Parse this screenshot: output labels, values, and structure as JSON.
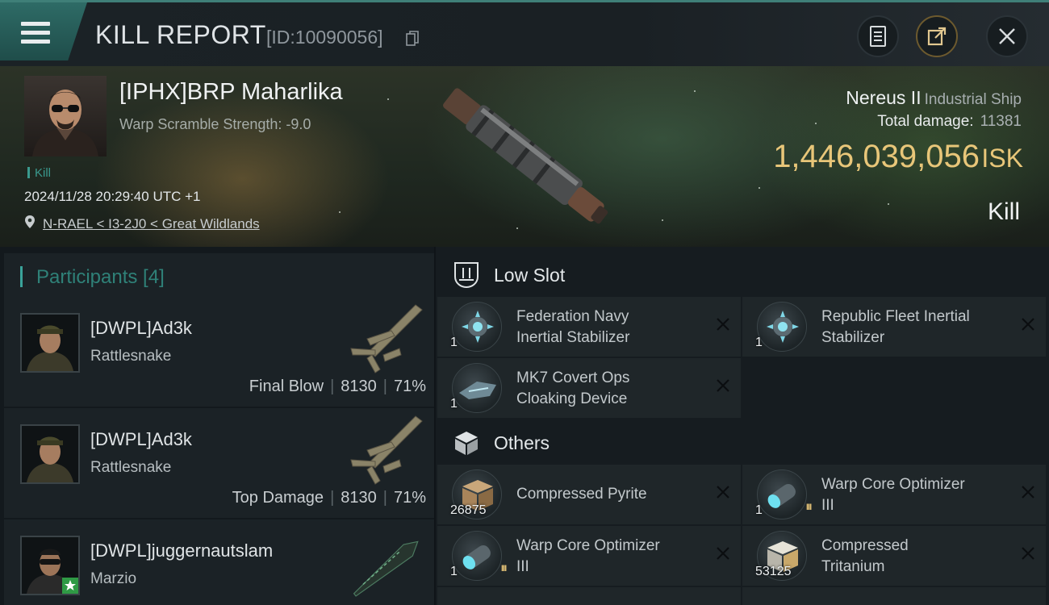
{
  "header": {
    "title": "KILL REPORT",
    "report_id": "[ID:10090056]"
  },
  "victim": {
    "name": "[IPHX]BRP Maharlika",
    "warp_scramble": "Warp Scramble Strength: -9.0",
    "tag": "Kill",
    "time": "2024/11/28 20:29:40 UTC +1",
    "location": "N-RAEL < I3-2J0 < Great Wildlands",
    "ship_name": "Nereus II",
    "ship_class": "Industrial Ship",
    "total_damage_label": "Total damage:",
    "total_damage": "11381",
    "isk_value": "1,446,039,056",
    "isk_unit": "ISK",
    "result": "Kill"
  },
  "participants": {
    "title": "Participants [4]",
    "items": [
      {
        "name": "[DWPL]Ad3k",
        "ship": "Rattlesnake",
        "role": "Final Blow",
        "damage": "8130",
        "percent": "71%"
      },
      {
        "name": "[DWPL]Ad3k",
        "ship": "Rattlesnake",
        "role": "Top Damage",
        "damage": "8130",
        "percent": "71%"
      },
      {
        "name": "[DWPL]juggernautslam",
        "ship": "Marzio",
        "role": "",
        "damage": "",
        "percent": ""
      }
    ]
  },
  "low_slot": {
    "title": "Low Slot",
    "items": [
      {
        "line1": "Federation Navy",
        "line2": "Inertial Stabilizer",
        "qty": "1"
      },
      {
        "line1": "Republic Fleet Inertial",
        "line2": "Stabilizer",
        "qty": "1"
      },
      {
        "line1": "MK7 Covert Ops",
        "line2": "Cloaking Device",
        "qty": "1"
      }
    ]
  },
  "others": {
    "title": "Others",
    "items": [
      {
        "line1": "Compressed Pyrite",
        "line2": "",
        "qty": "26875"
      },
      {
        "line1": "Warp Core Optimizer",
        "line2": "III",
        "qty": "1"
      },
      {
        "line1": "Warp Core Optimizer",
        "line2": "III",
        "qty": "1"
      },
      {
        "line1": "Compressed",
        "line2": "Tritanium",
        "qty": "53125"
      }
    ]
  },
  "colors": {
    "accent": "#3aa39a",
    "isk": "#e8c679"
  }
}
